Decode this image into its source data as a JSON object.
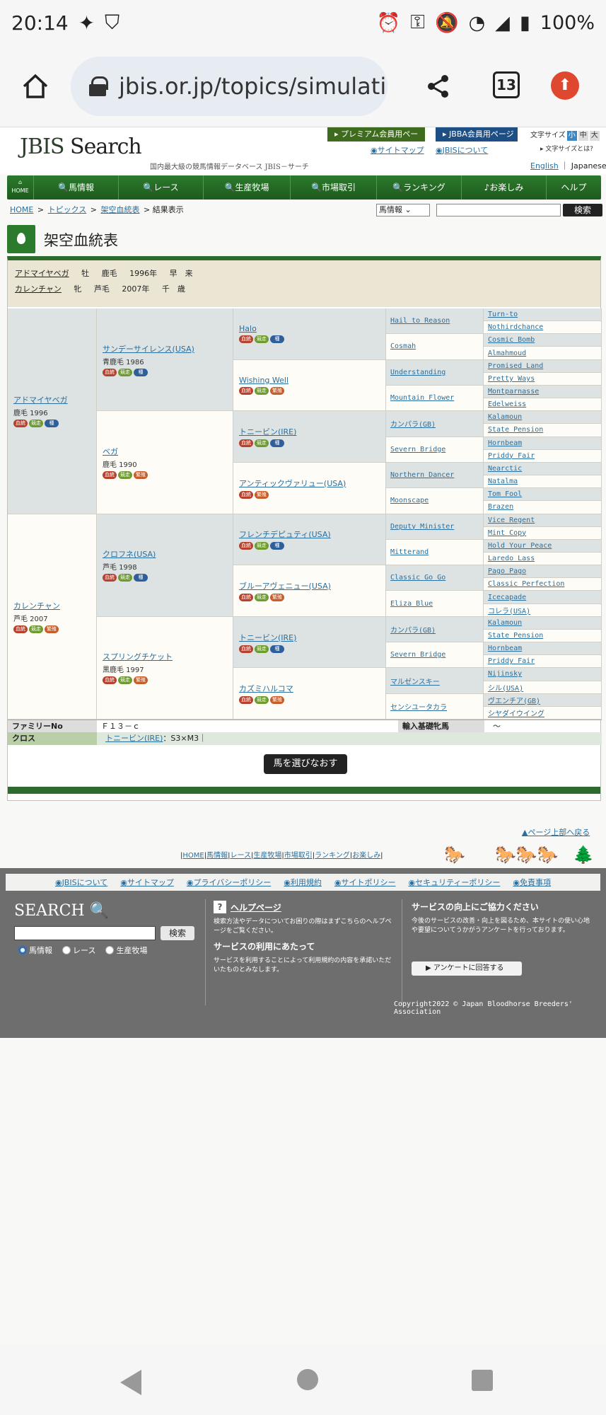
{
  "status": {
    "time": "20:14",
    "battery": "100%"
  },
  "browser": {
    "url": "jbis.or.jp/topics/simulati",
    "tab_count": "13"
  },
  "header": {
    "logo_a": "JBIS",
    "logo_b": "Search",
    "tagline": "国内最大級の競馬情報データベース JBIS－サーチ",
    "premium": "プレミアム会員用ページ",
    "jbba": "JBBA会員用ページ",
    "sitemap": "サイトマップ",
    "about": "JBISについて",
    "fontsize_label": "文字サイズ",
    "fontsize_options": [
      "小",
      "中",
      "大"
    ],
    "fontsize_help": "文字サイズとは?",
    "lang_en": "English",
    "lang_ja": "Japanese"
  },
  "nav": [
    "HOME",
    "馬情報",
    "レース",
    "生産牧場",
    "市場取引",
    "ランキング",
    "お楽しみ",
    "ヘルプ"
  ],
  "breadcrumb": [
    "HOME",
    "トピックス",
    "架空血統表",
    "結果表示"
  ],
  "search": {
    "select": "馬情報",
    "button": "検索"
  },
  "page_title": "架空血統表",
  "summary": [
    {
      "name": "アドマイヤベガ",
      "sex": "牡",
      "color": "鹿毛",
      "year": "1996年",
      "region": "早　来"
    },
    {
      "name": "カレンチャン",
      "sex": "牝",
      "color": "芦毛",
      "year": "2007年",
      "region": "千　歳"
    }
  ],
  "badges": {
    "blood": "血統",
    "race": "競走",
    "breed": "種",
    "prod": "繁殖"
  },
  "pedigree": {
    "gen1": [
      {
        "name": "アドマイヤベガ",
        "info": "鹿毛 1996"
      },
      {
        "name": "カレンチャン",
        "info": "芦毛 2007"
      }
    ],
    "gen2": [
      {
        "name": "サンデーサイレンス(USA)",
        "info": "青鹿毛 1986"
      },
      {
        "name": "ベガ",
        "info": "鹿毛 1990"
      },
      {
        "name": "クロフネ(USA)",
        "info": "芦毛 1998"
      },
      {
        "name": "スプリングチケット",
        "info": "黒鹿毛 1997"
      }
    ],
    "gen3": [
      "Halo",
      "Wishing Well",
      "トニービン(IRE)",
      "アンティックヴァリュー(USA)",
      "フレンチデピュティ(USA)",
      "ブルーアヴェニュー(USA)",
      "トニービン(IRE)",
      "カズミハルコマ"
    ],
    "gen4": [
      "Hail to Reason",
      "Cosmah",
      "Understanding",
      "Mountain Flower",
      "カンパラ(GB)",
      "Severn Bridge",
      "Northern Dancer",
      "Moonscape",
      "Deputy Minister",
      "Mitterand",
      "Classic Go Go",
      "Eliza Blue",
      "カンパラ(GB)",
      "Severn Bridge",
      "マルゼンスキー",
      "センシユータカラ"
    ],
    "gen5": [
      "Turn-to",
      "Nothirdchance",
      "Cosmic Bomb",
      "Almahmoud",
      "Promised Land",
      "Pretty Ways",
      "Montparnasse",
      "Edelweiss",
      "Kalamoun",
      "State Pension",
      "Hornbeam",
      "Priddy Fair",
      "Nearctic",
      "Natalma",
      "Tom Fool",
      "Brazen",
      "Vice Regent",
      "Mint Copy",
      "Hold Your Peace",
      "Laredo Lass",
      "Pago Pago",
      "Classic Perfection",
      "Icecapade",
      "コレラ(USA)",
      "Kalamoun",
      "State Pension",
      "Hornbeam",
      "Priddy Fair",
      "Nijinsky",
      "シル(USA)",
      "ヴエンチア(GB)",
      "シヤダイウイング"
    ]
  },
  "family": {
    "label": "ファミリーNo",
    "value": "Ｆ１３－ｃ",
    "label2": "輸入基礎牝馬",
    "value2": "～"
  },
  "cross": {
    "label": "クロス",
    "horse": "トニービン(IRE)",
    "detail": "：S3×M3｜"
  },
  "reselect": "馬を選びなおす",
  "to_top": "ページ上部へ戻る",
  "footer_nav": [
    "HOME",
    "馬情報",
    "レース",
    "生産牧場",
    "市場取引",
    "ランキング",
    "お楽しみ"
  ],
  "footer_links": [
    "JBISについて",
    "サイトマップ",
    "プライバシーポリシー",
    "利用規約",
    "サイトポリシー",
    "セキュリティーポリシー",
    "免責事項"
  ],
  "footer": {
    "search_title": "SEARCH",
    "search_btn": "検索",
    "radios": [
      "馬情報",
      "レース",
      "生産牧場"
    ],
    "help_title": "ヘルプページ",
    "help_text": "検索方法やデータについてお困りの際はまずこちらのヘルプページをご覧ください。",
    "use_title": "サービスの利用にあたって",
    "use_text": "サービスを利用することによって利用規約の内容を承諾いただいたものとみなします。",
    "svc_title": "サービスの向上にご協力ください",
    "svc_text": "今後のサービスの改善・向上を図るため、本サイトの使い心地や要望についてうかがうアンケートを行っております。",
    "svc_btn": "アンケートに回答する",
    "copyright": "Copyright2022 © Japan Bloodhorse Breeders' Association"
  }
}
